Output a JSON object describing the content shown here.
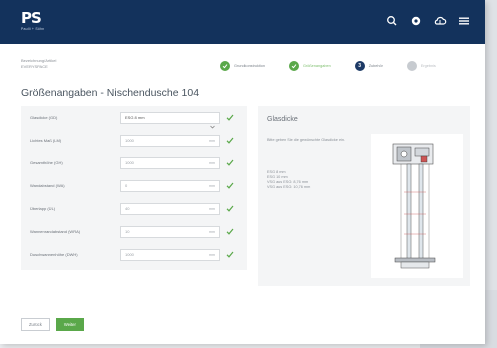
{
  "header": {
    "logo_mark": "PS",
    "logo_sub": "Paulli + Söhn",
    "icons": [
      "search-icon",
      "globe-icon",
      "cloud-icon",
      "menu-icon"
    ]
  },
  "page": {
    "eyebrow_line1": "Bezeichnung/Artikel",
    "eyebrow_line2": "EVERYSPACE",
    "title": "Größenangaben - Nischendusche 104"
  },
  "steps": [
    {
      "label": "Grundkonstruktion",
      "state": "done"
    },
    {
      "label": "Größenangaben",
      "state": "active-done"
    },
    {
      "label": "Zubehör",
      "state": "current",
      "number": "3"
    },
    {
      "label": "Ergebnis",
      "state": "todo"
    }
  ],
  "form": {
    "rows": [
      {
        "label": "Glasdicke (GD)",
        "value": "ESG 8 mm",
        "unit": "",
        "type": "select"
      },
      {
        "label": "Lichtes Maß (LM)",
        "value": "1000",
        "unit": "mm",
        "type": "input"
      },
      {
        "label": "Gesamthöhe (GH)",
        "value": "1000",
        "unit": "mm",
        "type": "input"
      },
      {
        "label": "Wandabstand (WA)",
        "value": "0",
        "unit": "mm",
        "type": "input"
      },
      {
        "label": "Überlapp (ÜL)",
        "value": "40",
        "unit": "mm",
        "type": "input"
      },
      {
        "label": "Wannenrandabstand (WRA)",
        "value": "10",
        "unit": "mm",
        "type": "input"
      },
      {
        "label": "Duschwannenhöhe (DWH)",
        "value": "1000",
        "unit": "mm",
        "type": "input"
      }
    ]
  },
  "info": {
    "title": "Glasdicke",
    "description": "Bitte geben Sie die gewünschte Glasdicke ein.",
    "options": [
      "ESG 8 mm",
      "ESG 10 mm",
      "VSG aus ESG: 8,76 mm",
      "VSG aus ESG: 10,76 mm"
    ]
  },
  "buttons": {
    "back": "Zurück",
    "next": "Weiter"
  },
  "colors": {
    "header_bg": "#13325c",
    "accent_green": "#5aa84a",
    "step_current": "#1d3a66"
  }
}
